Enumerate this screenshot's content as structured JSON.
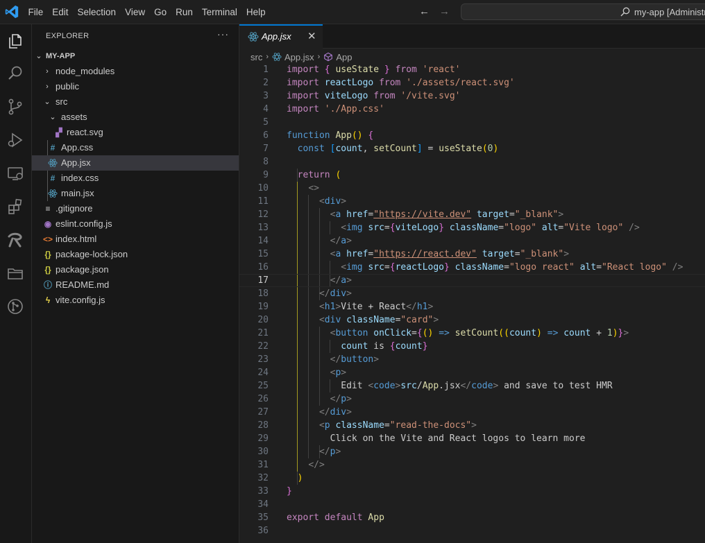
{
  "menu": [
    "File",
    "Edit",
    "Selection",
    "View",
    "Go",
    "Run",
    "Terminal",
    "Help"
  ],
  "search_text": "my-app [Administrator]",
  "explorer": {
    "title": "EXPLORER",
    "more": "···",
    "tree": [
      {
        "label": "MY-APP",
        "kind": "root"
      },
      {
        "label": "node_modules",
        "kind": "folder"
      },
      {
        "label": "public",
        "kind": "folder"
      },
      {
        "label": "src",
        "kind": "folder-open"
      },
      {
        "label": "assets",
        "kind": "folder-open"
      },
      {
        "label": "react.svg",
        "kind": "svg"
      },
      {
        "label": "App.css",
        "kind": "css"
      },
      {
        "label": "App.jsx",
        "kind": "jsx"
      },
      {
        "label": "index.css",
        "kind": "css"
      },
      {
        "label": "main.jsx",
        "kind": "jsx"
      },
      {
        "label": ".gitignore",
        "kind": "gitignore"
      },
      {
        "label": "eslint.config.js",
        "kind": "eslint"
      },
      {
        "label": "index.html",
        "kind": "html"
      },
      {
        "label": "package-lock.json",
        "kind": "json"
      },
      {
        "label": "package.json",
        "kind": "json"
      },
      {
        "label": "README.md",
        "kind": "readme"
      },
      {
        "label": "vite.config.js",
        "kind": "vite"
      }
    ]
  },
  "editor": {
    "tab": {
      "label": "App.jsx",
      "close": "✕"
    },
    "breadcrumb": [
      "src",
      "App.jsx",
      "App"
    ],
    "current_line": 17,
    "lines": [
      "import { useState } from 'react'",
      "import reactLogo from './assets/react.svg'",
      "import viteLogo from '/vite.svg'",
      "import './App.css'",
      "",
      "function App() {",
      "  const [count, setCount] = useState(0)",
      "",
      "  return (",
      "    <>",
      "      <div>",
      "        <a href=\"https://vite.dev\" target=\"_blank\">",
      "          <img src={viteLogo} className=\"logo\" alt=\"Vite logo\" />",
      "        </a>",
      "        <a href=\"https://react.dev\" target=\"_blank\">",
      "          <img src={reactLogo} className=\"logo react\" alt=\"React logo\" />",
      "        </a>",
      "      </div>",
      "      <h1>Vite + React</h1>",
      "      <div className=\"card\">",
      "        <button onClick={() => setCount((count) => count + 1)}>",
      "          count is {count}",
      "        </button>",
      "        <p>",
      "          Edit <code>src/App.jsx</code> and save to test HMR",
      "        </p>",
      "      </div>",
      "      <p className=\"read-the-docs\">",
      "        Click on the Vite and React logos to learn more",
      "      </p>",
      "    </>",
      "  )",
      "}",
      "",
      "export default App",
      ""
    ]
  },
  "colors": {
    "accent": "#0078d4",
    "keyword": "#c586c0",
    "string": "#ce9178",
    "function": "#dcdcaa",
    "variable": "#9cdcfe",
    "tag": "#569cd6"
  }
}
